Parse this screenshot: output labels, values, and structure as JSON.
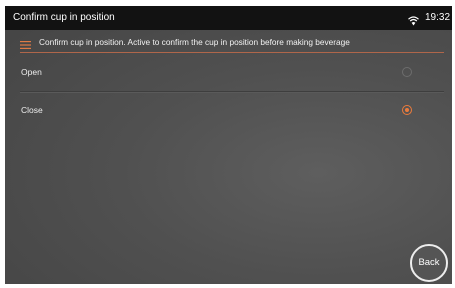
{
  "status_bar": {
    "title": "Confirm cup in position",
    "time": "19:32",
    "wifi_icon": "wifi-icon"
  },
  "header": {
    "menu_icon": "menu-icon",
    "text": "Confirm cup in position. Active to confirm the cup in position before making beverage"
  },
  "options": [
    {
      "label": "Open",
      "selected": false
    },
    {
      "label": "Close",
      "selected": true
    }
  ],
  "back_button": {
    "label": "Back"
  },
  "colors": {
    "accent": "#ec7b3c",
    "status_bar_bg": "#121212",
    "background": "#505050"
  }
}
